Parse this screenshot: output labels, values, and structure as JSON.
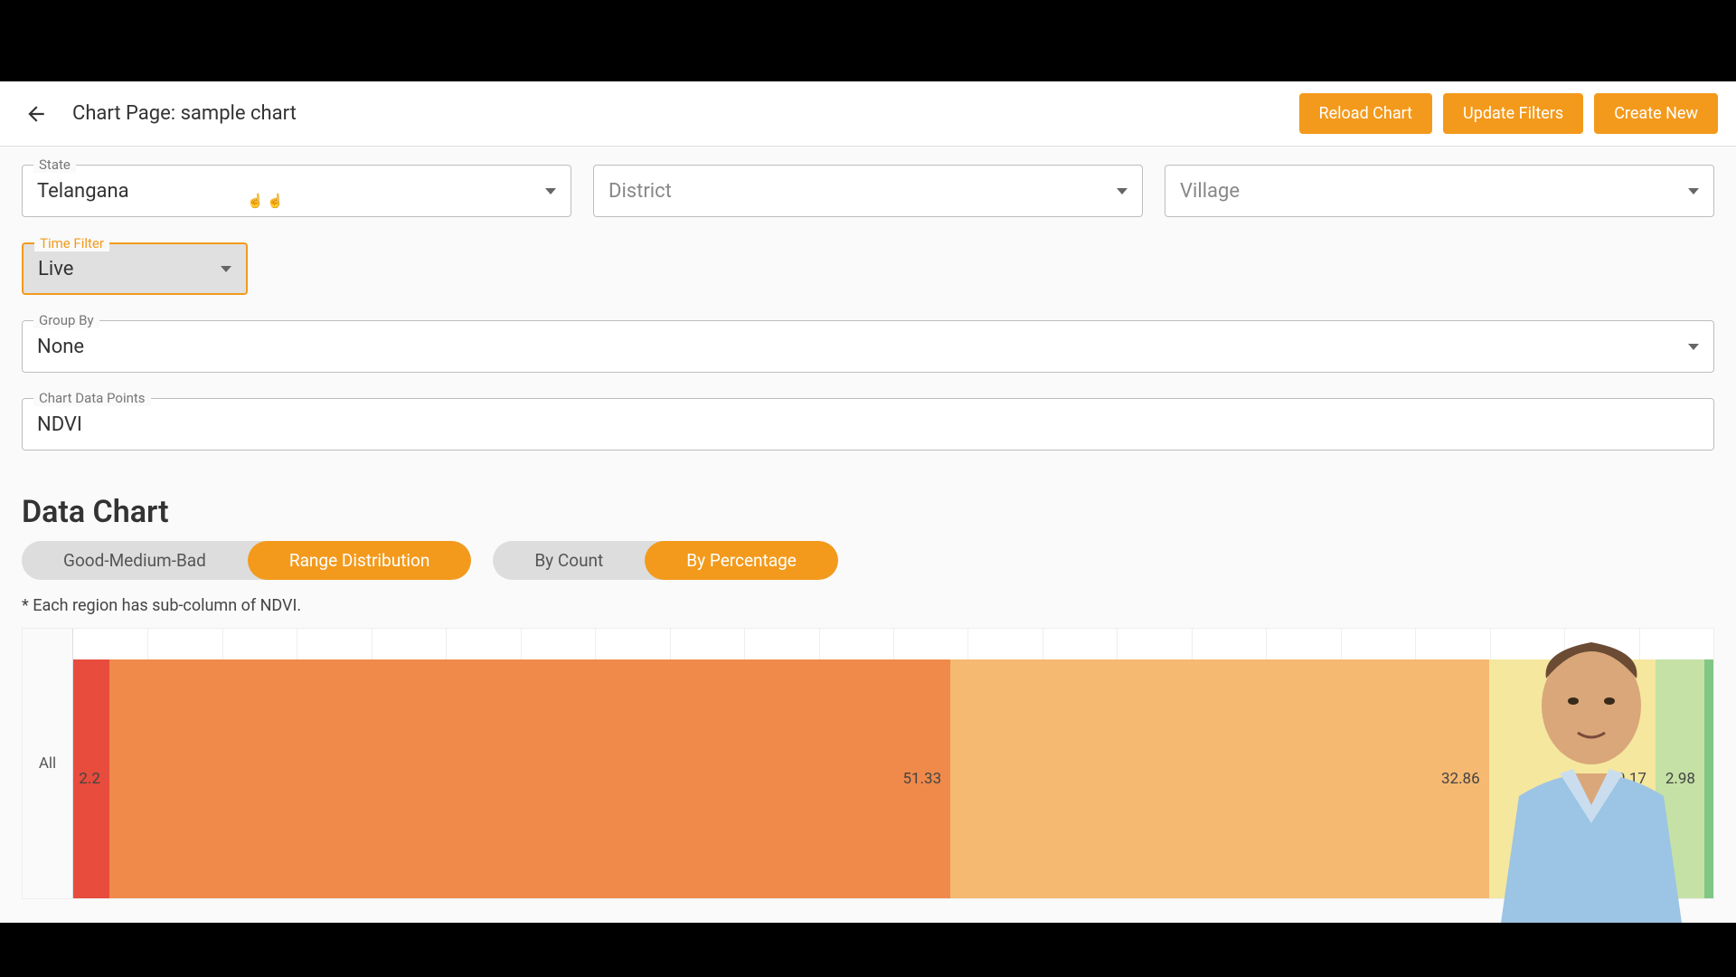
{
  "header": {
    "title": "Chart Page: sample chart",
    "buttons": {
      "reload": "Reload Chart",
      "update": "Update Filters",
      "create": "Create New"
    }
  },
  "filters": {
    "state": {
      "label": "State",
      "value": "Telangana"
    },
    "district": {
      "label": "District",
      "value": ""
    },
    "village": {
      "label": "Village",
      "value": ""
    },
    "time": {
      "label": "Time Filter",
      "value": "Live"
    },
    "groupby": {
      "label": "Group By",
      "value": "None"
    },
    "datapoints": {
      "label": "Chart Data Points",
      "value": "NDVI"
    }
  },
  "section_title": "Data Chart",
  "toggles": {
    "group1": {
      "options": [
        "Good-Medium-Bad",
        "Range Distribution"
      ],
      "active": 1
    },
    "group2": {
      "options": [
        "By Count",
        "By Percentage"
      ],
      "active": 1
    }
  },
  "footnote": "* Each region has sub-column of NDVI.",
  "chart_data": {
    "type": "bar",
    "orientation": "horizontal-stacked",
    "categories": [
      "All"
    ],
    "xlabel": "",
    "ylabel": "",
    "xlim": [
      0,
      100
    ],
    "series": [
      {
        "name": "seg1",
        "color": "#e74c3c",
        "values": [
          2.2
        ]
      },
      {
        "name": "seg2",
        "color": "#f08a4b",
        "values": [
          51.33
        ]
      },
      {
        "name": "seg3",
        "color": "#f5b971",
        "values": [
          32.86
        ]
      },
      {
        "name": "seg4",
        "color": "#f5e79e",
        "values": [
          10.17
        ]
      },
      {
        "name": "seg5",
        "color": "#c5e1a5",
        "values": [
          2.98
        ]
      },
      {
        "name": "seg6",
        "color": "#81c784",
        "values": [
          0.46
        ]
      }
    ]
  }
}
